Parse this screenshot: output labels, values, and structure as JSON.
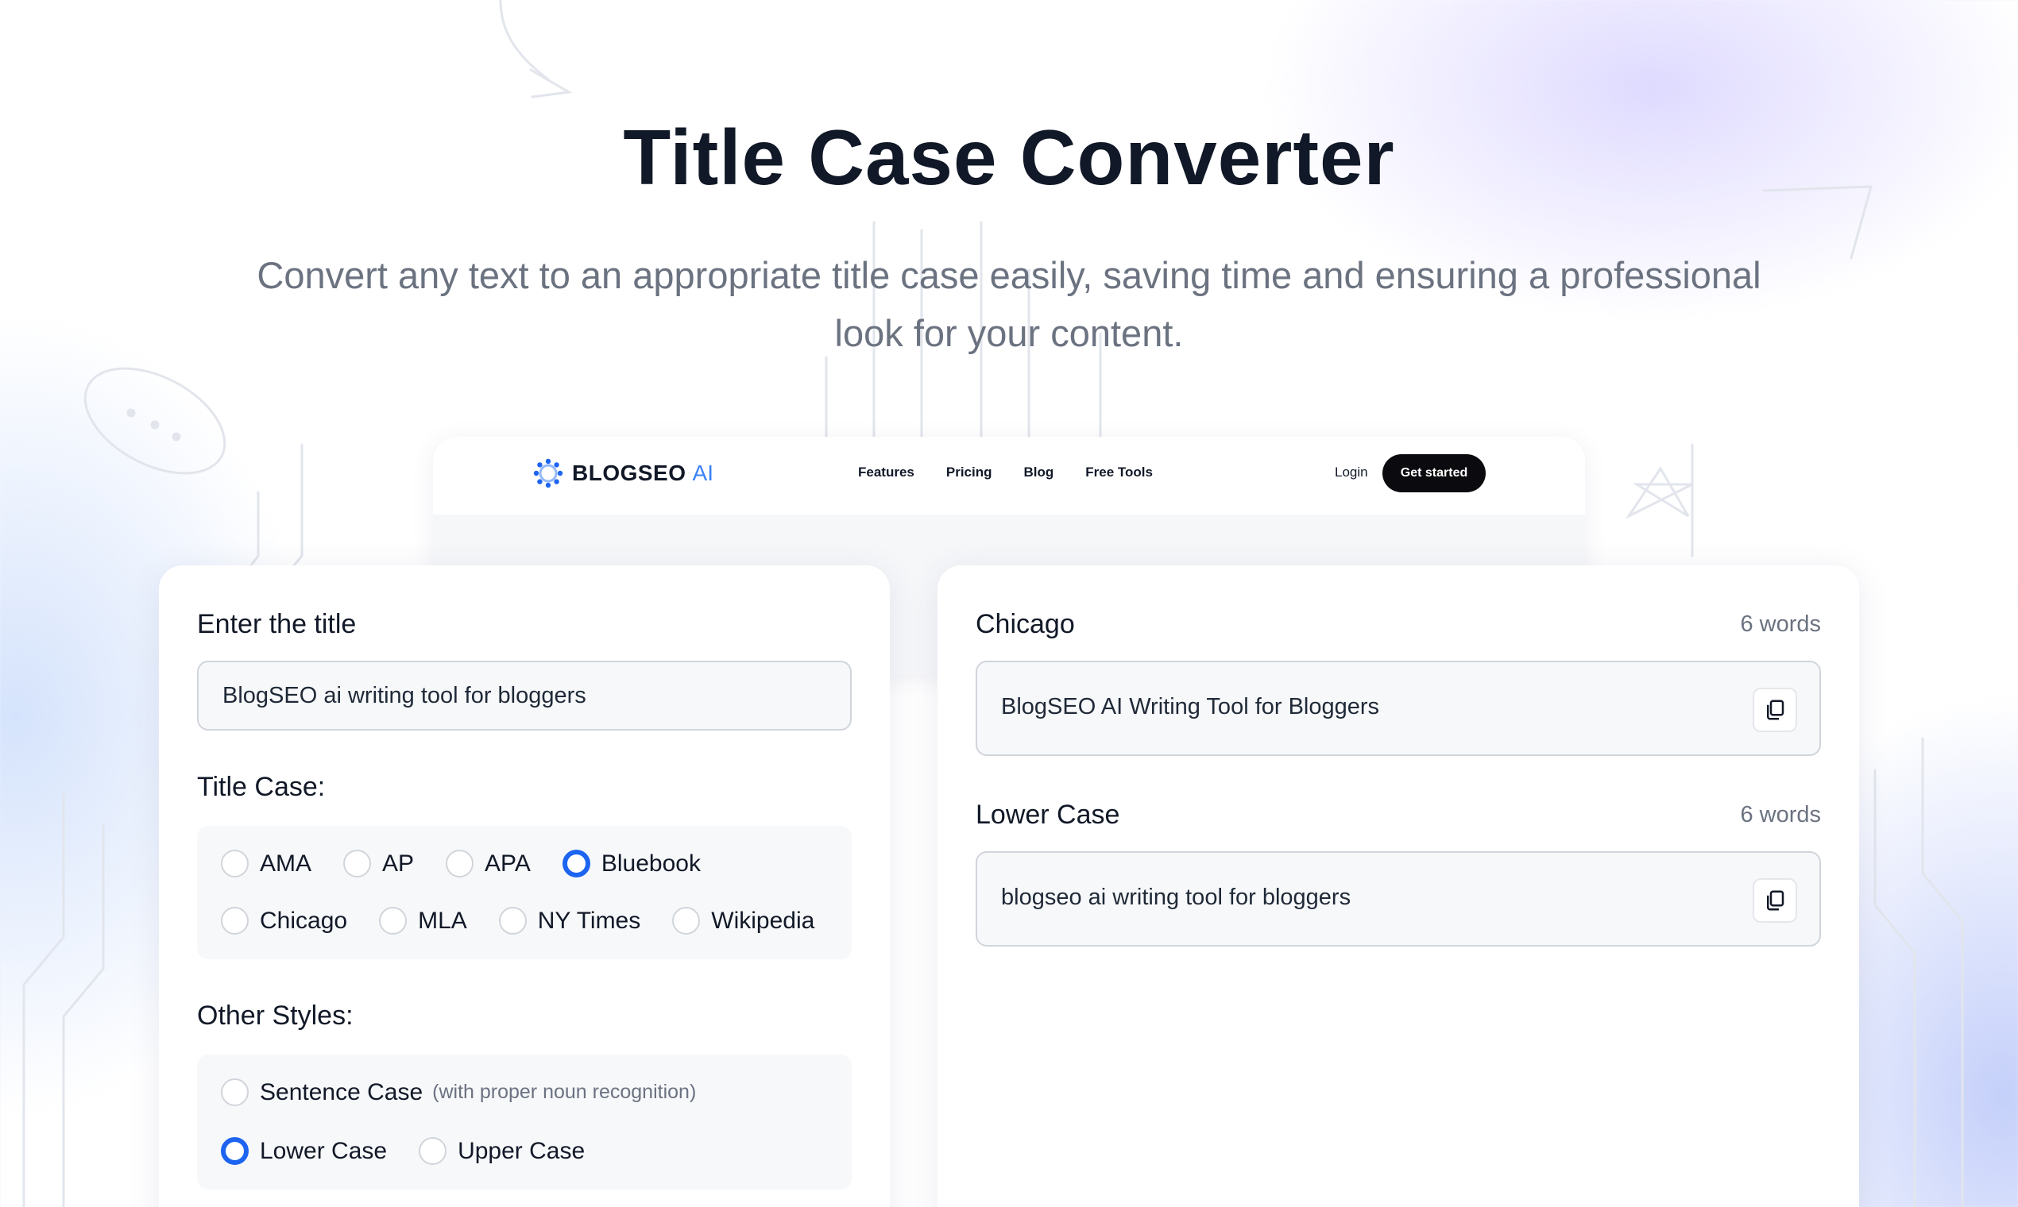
{
  "hero": {
    "title": "Title Case Converter",
    "subtitle_line1": "Convert any text to an appropriate title case easily, saving time and ensuring a professional",
    "subtitle_line2": "look for your content."
  },
  "preview": {
    "brand_name": "BLOGSEO",
    "brand_suffix": "AI",
    "nav_links": [
      "Features",
      "Pricing",
      "Blog",
      "Free Tools"
    ],
    "login": "Login",
    "cta": "Get started"
  },
  "input_panel": {
    "label": "Enter the title",
    "value": "BlogSEO ai writing tool for bloggers",
    "title_case_heading": "Title Case:",
    "title_case_options": [
      {
        "label": "AMA",
        "checked": false
      },
      {
        "label": "AP",
        "checked": false
      },
      {
        "label": "APA",
        "checked": false
      },
      {
        "label": "Bluebook",
        "checked": true
      },
      {
        "label": "Chicago",
        "checked": false
      },
      {
        "label": "MLA",
        "checked": false
      },
      {
        "label": "NY Times",
        "checked": false
      },
      {
        "label": "Wikipedia",
        "checked": false
      }
    ],
    "other_styles_heading": "Other Styles:",
    "other_styles": [
      {
        "label": "Sentence Case",
        "hint": "(with proper noun recognition)",
        "checked": false
      },
      {
        "label": "Lower Case",
        "checked": true
      },
      {
        "label": "Upper Case",
        "checked": false
      }
    ]
  },
  "results": [
    {
      "label": "Chicago",
      "count": "6 words",
      "text": "BlogSEO AI Writing Tool for Bloggers",
      "icon": "copy-icon"
    },
    {
      "label": "Lower Case",
      "count": "6 words",
      "text": "blogseo ai writing tool for bloggers",
      "icon": "copy-icon"
    }
  ],
  "colors": {
    "accent": "#1d64f0",
    "brand_ai": "#3b82f6",
    "heading": "#111827",
    "muted": "#6b7280"
  }
}
